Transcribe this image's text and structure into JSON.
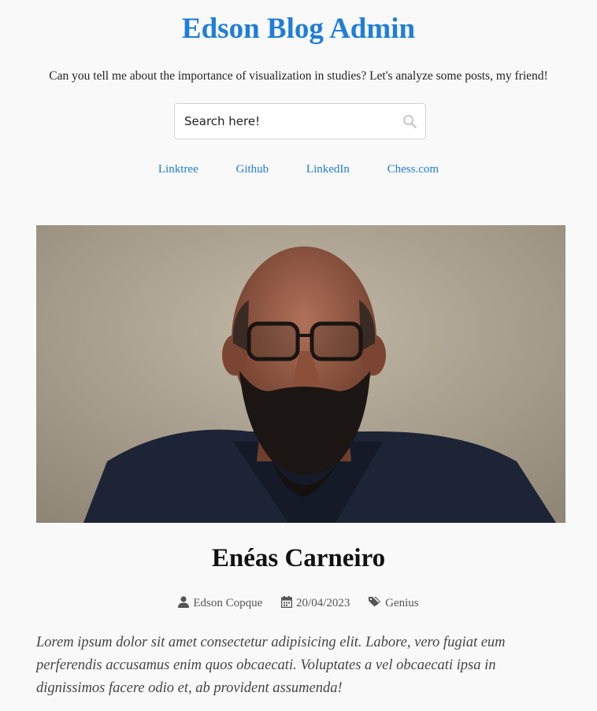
{
  "header": {
    "title": "Edson Blog Admin",
    "tagline": "Can you tell me about the importance of visualization in studies? Let's analyze some posts, my friend!"
  },
  "search": {
    "placeholder": "Search here!",
    "icon": "search-icon"
  },
  "links": [
    {
      "label": "Linktree"
    },
    {
      "label": "Github"
    },
    {
      "label": "LinkedIn"
    },
    {
      "label": "Chess.com"
    }
  ],
  "post": {
    "title": "Enéas Carneiro",
    "author": "Edson Copque",
    "date": "20/04/2023",
    "category": "Genius",
    "excerpt": "Lorem ipsum dolor sit amet consectetur adipisicing elit. Labore, vero fugiat eum perferendis accusamus enim quos obcaecati. Voluptates a vel obcaecati ipsa in dignissimos facere odio et, ab provident assumenda!",
    "icons": {
      "author": "user-icon",
      "date": "calendar-icon",
      "category": "tags-icon"
    }
  },
  "colors": {
    "accent": "#1f7ed8",
    "background": "#f9f9f9"
  }
}
